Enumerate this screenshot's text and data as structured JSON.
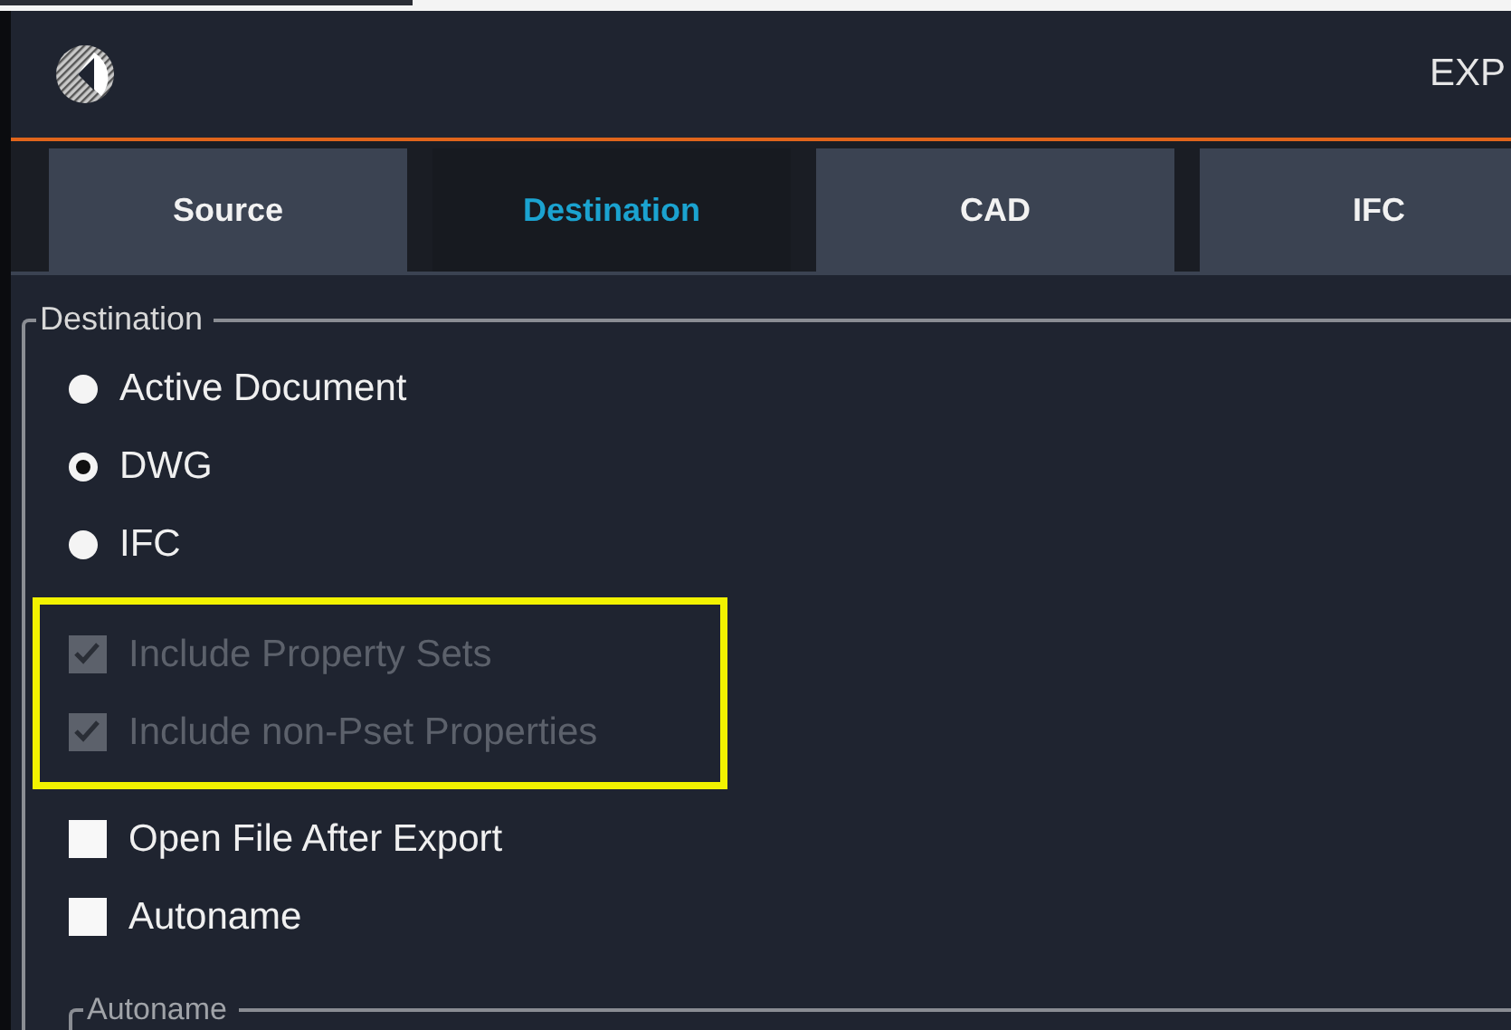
{
  "header": {
    "title": "EXP"
  },
  "tabs": [
    {
      "label": "Source",
      "selected": false
    },
    {
      "label": "Destination",
      "selected": true
    },
    {
      "label": "CAD",
      "selected": false
    },
    {
      "label": "IFC",
      "selected": false
    }
  ],
  "destination": {
    "legend": "Destination",
    "options": [
      {
        "label": "Active Document",
        "selected": false
      },
      {
        "label": "DWG",
        "selected": true
      },
      {
        "label": "IFC",
        "selected": false
      }
    ],
    "highlighted_checkboxes": [
      {
        "label": "Include Property Sets",
        "checked": true,
        "disabled": true
      },
      {
        "label": "Include non-Pset Properties",
        "checked": true,
        "disabled": true
      }
    ],
    "checkboxes": [
      {
        "label": "Open File After Export",
        "checked": false,
        "disabled": false
      },
      {
        "label": "Autoname",
        "checked": false,
        "disabled": false
      }
    ],
    "autoname": {
      "legend": "Autoname"
    }
  }
}
